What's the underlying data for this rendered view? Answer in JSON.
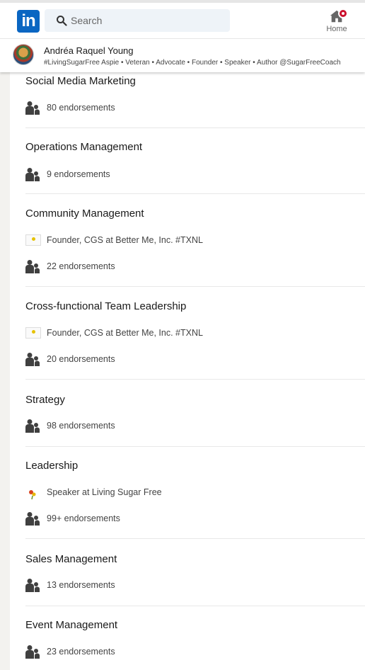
{
  "header": {
    "logo_text": "in",
    "search_placeholder": "Search",
    "home_label": "Home"
  },
  "profile": {
    "name": "Andréa Raquel Young",
    "headline": "#LivingSugarFree Aspie • Veteran • Advocate • Founder • Speaker • Author @SugarFreeCoach"
  },
  "skills": [
    {
      "name": "Social Media Marketing",
      "endorsements": "80 endorsements"
    },
    {
      "name": "Operations Management",
      "endorsements": "9 endorsements"
    },
    {
      "name": "Community Management",
      "experience": "Founder, CGS at Better Me, Inc. #TXNL",
      "endorsements": "22 endorsements"
    },
    {
      "name": "Cross-functional Team Leadership",
      "experience": "Founder, CGS at Better Me, Inc. #TXNL",
      "endorsements": "20 endorsements"
    },
    {
      "name": "Strategy",
      "endorsements": "98 endorsements"
    },
    {
      "name": "Leadership",
      "experience": "Speaker at Living Sugar Free",
      "endorsements": "99+ endorsements"
    },
    {
      "name": "Sales Management",
      "endorsements": "13 endorsements"
    },
    {
      "name": "Event Management",
      "endorsements": "23 endorsements"
    }
  ],
  "colors": {
    "brand": "#0a66c2",
    "badge": "#cb112d"
  },
  "icons": {
    "people": "people-icon",
    "search": "search-icon",
    "home": "home-icon"
  }
}
